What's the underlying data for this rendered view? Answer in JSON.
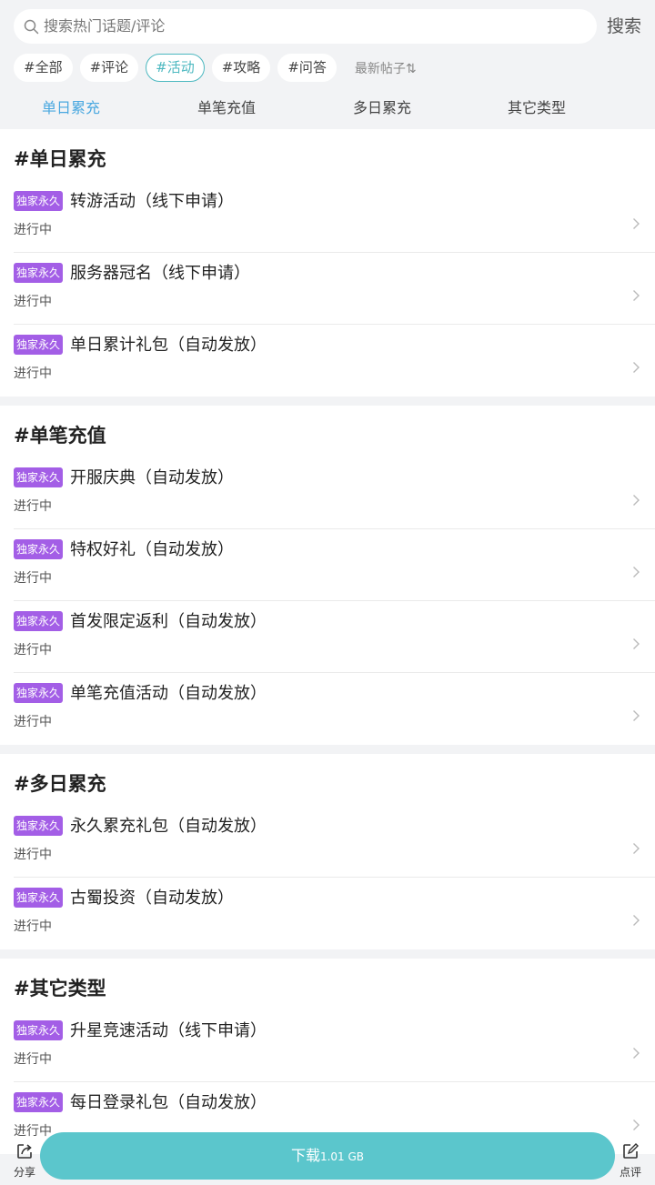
{
  "search": {
    "placeholder": "搜索热门话题/评论",
    "button": "搜索"
  },
  "tags": [
    "#全部",
    "#评论",
    "#活动",
    "#攻略",
    "#问答"
  ],
  "sort_label": "最新帖子⇅",
  "subtabs": [
    "单日累充",
    "单笔充值",
    "多日累充",
    "其它类型"
  ],
  "sections": [
    {
      "title": "#单日累充",
      "items": [
        {
          "badge": "独家永久",
          "title": "转游活动（线下申请）",
          "status": "进行中"
        },
        {
          "badge": "独家永久",
          "title": "服务器冠名（线下申请）",
          "status": "进行中"
        },
        {
          "badge": "独家永久",
          "title": "单日累计礼包（自动发放）",
          "status": "进行中"
        }
      ]
    },
    {
      "title": "#单笔充值",
      "items": [
        {
          "badge": "独家永久",
          "title": "开服庆典（自动发放）",
          "status": "进行中"
        },
        {
          "badge": "独家永久",
          "title": "特权好礼（自动发放）",
          "status": "进行中"
        },
        {
          "badge": "独家永久",
          "title": "首发限定返利（自动发放）",
          "status": "进行中"
        },
        {
          "badge": "独家永久",
          "title": "单笔充值活动（自动发放）",
          "status": "进行中"
        }
      ]
    },
    {
      "title": "#多日累充",
      "items": [
        {
          "badge": "独家永久",
          "title": "永久累充礼包（自动发放）",
          "status": "进行中"
        },
        {
          "badge": "独家永久",
          "title": "古蜀投资（自动发放）",
          "status": "进行中"
        }
      ]
    },
    {
      "title": "#其它类型",
      "items": [
        {
          "badge": "独家永久",
          "title": "升星竞速活动（线下申请）",
          "status": "进行中"
        },
        {
          "badge": "独家永久",
          "title": "每日登录礼包（自动发放）",
          "status": "进行中"
        }
      ]
    }
  ],
  "bottom": {
    "share_label": "分享",
    "download_label": "下载",
    "download_size": "1.01 GB",
    "review_label": "点评"
  },
  "colors": {
    "accent": "#4cb8c0",
    "badge": "#a35ee6",
    "download": "#5bc6cc",
    "subtab_active": "#4aa8e0"
  }
}
